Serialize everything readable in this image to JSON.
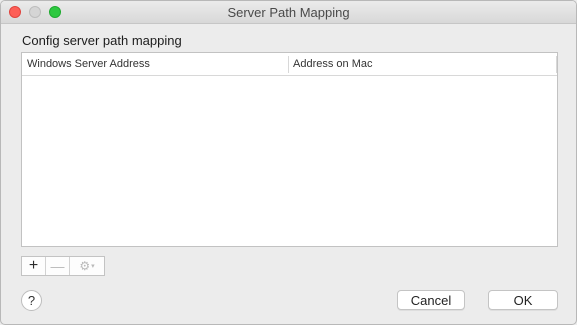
{
  "window": {
    "title": "Server Path Mapping",
    "traffic_colors": {
      "close": "#fd5f57",
      "minimize": "#d5d5d5",
      "zoom": "#2ec840"
    }
  },
  "main": {
    "heading": "Config server path mapping",
    "table": {
      "columns": [
        "Windows Server Address",
        "Address on Mac"
      ],
      "rows": []
    },
    "toolbar": {
      "add_label": "+",
      "remove_label": "—",
      "gear_label": "⚙",
      "gear_caret": "▾"
    }
  },
  "footer": {
    "help_label": "?",
    "cancel_label": "Cancel",
    "ok_label": "OK"
  }
}
